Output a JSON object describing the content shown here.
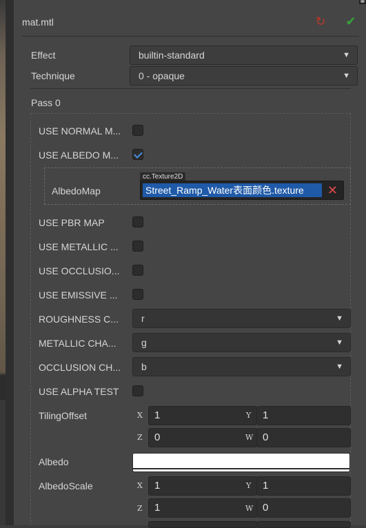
{
  "header": {
    "title": "mat.mtl",
    "revert_icon": "refresh-icon",
    "apply_icon": "check-icon",
    "revert_color": "#b53a2a",
    "apply_color": "#3aa13a"
  },
  "effect": {
    "label": "Effect",
    "value": "builtin-standard"
  },
  "technique": {
    "label": "Technique",
    "value": "0 - opaque"
  },
  "pass": {
    "label": "Pass 0"
  },
  "options": [
    {
      "label": "USE NORMAL M...",
      "checked": false
    },
    {
      "label": "USE ALBEDO M...",
      "checked": true
    },
    {
      "label": "USE PBR MAP",
      "checked": false
    },
    {
      "label": "USE METALLIC ...",
      "checked": false
    },
    {
      "label": "USE OCCLUSIO...",
      "checked": false
    },
    {
      "label": "USE EMISSIVE ...",
      "checked": false
    },
    {
      "label": "USE ALPHA TEST",
      "checked": false
    }
  ],
  "albedo_map": {
    "label": "AlbedoMap",
    "type_tag": "cc.Texture2D",
    "asset": "Street_Ramp_Water表面颜色.texture",
    "clear_icon": "close-icon"
  },
  "channels": [
    {
      "label": "ROUGHNESS C...",
      "value": "r"
    },
    {
      "label": "METALLIC CHA...",
      "value": "g"
    },
    {
      "label": "OCCLUSION CH...",
      "value": "b"
    }
  ],
  "tiling_offset": {
    "label": "TilingOffset",
    "x": "1",
    "y": "1",
    "z": "0",
    "w": "0"
  },
  "albedo": {
    "label": "Albedo",
    "color": "#ffffff"
  },
  "albedo_scale": {
    "label": "AlbedoScale",
    "x": "1",
    "y": "1",
    "z": "1",
    "w": "0"
  },
  "axes": {
    "x": "X",
    "y": "Y",
    "z": "Z",
    "w": "W"
  },
  "dropdown_arrow": "▼"
}
